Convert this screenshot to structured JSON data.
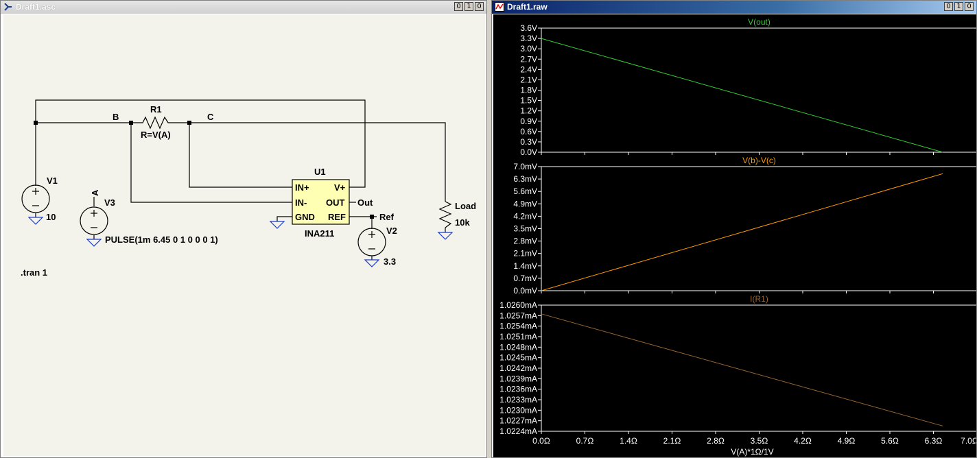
{
  "schematic_window": {
    "title": "Draft1.asc",
    "buttons": [
      "0",
      "1",
      "0"
    ],
    "labels": {
      "node_b": "B",
      "node_c": "C",
      "r1_name": "R1",
      "r1_value": "R=V(A)",
      "v1_name": "V1",
      "v1_value": "10",
      "v3_name": "V3",
      "v3_value": "PULSE(1m 6.45 0 1 0 0 0 1)",
      "v3_node": "A",
      "u1_name": "U1",
      "u1_part": "INA211",
      "pin_inp": "IN+",
      "pin_inn": "IN-",
      "pin_gnd": "GND",
      "pin_vp": "V+",
      "pin_out": "OUT",
      "pin_ref": "REF",
      "net_out": "Out",
      "net_ref": "Ref",
      "v2_name": "V2",
      "v2_value": "3.3",
      "load_name": "Load",
      "load_value": "10k",
      "directive": ".tran 1"
    }
  },
  "waveform_window": {
    "title": "Draft1.raw",
    "buttons": [
      "0",
      "1",
      "0"
    ],
    "trace_colors": {
      "vout": "#33cc33",
      "vdiff": "#ff9900",
      "ir1": "#996633"
    },
    "x_axis": {
      "label": "V(A)*1Ω/1V",
      "ticks": [
        "0.0Ω",
        "0.7Ω",
        "1.4Ω",
        "2.1Ω",
        "2.8Ω",
        "3.5Ω",
        "4.2Ω",
        "4.9Ω",
        "5.6Ω",
        "6.3Ω",
        "7.0Ω"
      ]
    }
  },
  "chart_data": [
    {
      "type": "line",
      "title": "V(out)",
      "xlim": [
        0,
        7.0
      ],
      "ylim": [
        0,
        3.6
      ],
      "y_ticks": [
        "3.6V",
        "3.3V",
        "3.0V",
        "2.7V",
        "2.4V",
        "2.1V",
        "1.8V",
        "1.5V",
        "1.2V",
        "0.9V",
        "0.6V",
        "0.3V",
        "0.0V"
      ],
      "series": [
        {
          "name": "V(out)",
          "color": "#33cc33",
          "x": [
            0.0,
            6.45
          ],
          "y": [
            3.3,
            0.0
          ]
        }
      ]
    },
    {
      "type": "line",
      "title": "V(b)-V(c)",
      "xlim": [
        0,
        7.0
      ],
      "ylim": [
        0,
        7.0
      ],
      "y_ticks": [
        "7.0mV",
        "6.3mV",
        "5.6mV",
        "4.9mV",
        "4.2mV",
        "3.5mV",
        "2.8mV",
        "2.1mV",
        "1.4mV",
        "0.7mV",
        "0.0mV"
      ],
      "series": [
        {
          "name": "V(b)-V(c)",
          "color": "#ff9900",
          "x": [
            0.0,
            6.45
          ],
          "y": [
            0.0,
            6.6
          ]
        }
      ]
    },
    {
      "type": "line",
      "title": "I(R1)",
      "xlim": [
        0,
        7.0
      ],
      "ylim": [
        1.0224,
        1.026
      ],
      "y_ticks": [
        "1.0260mA",
        "1.0257mA",
        "1.0254mA",
        "1.0251mA",
        "1.0248mA",
        "1.0245mA",
        "1.0242mA",
        "1.0239mA",
        "1.0236mA",
        "1.0233mA",
        "1.0230mA",
        "1.0227mA",
        "1.0224mA"
      ],
      "series": [
        {
          "name": "I(R1)",
          "color": "#996633",
          "x": [
            0.0,
            6.45
          ],
          "y": [
            1.02575,
            1.02255
          ]
        }
      ]
    }
  ]
}
